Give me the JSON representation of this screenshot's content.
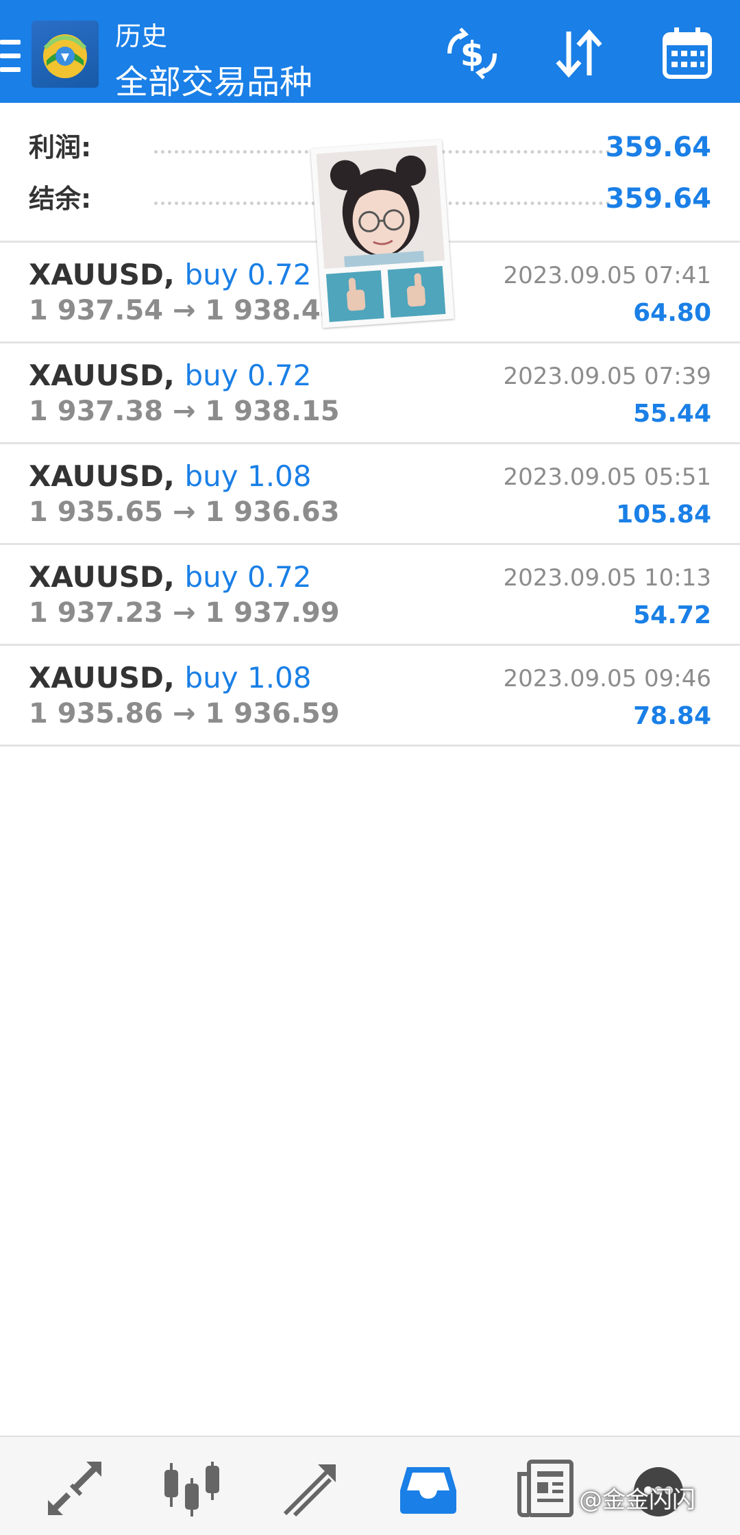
{
  "header": {
    "subtitle": "历史",
    "title": "全部交易品种",
    "icons": {
      "menu": "hamburger-icon",
      "logo": "metatrader-logo-icon",
      "currency": "currency-exchange-icon",
      "sort": "sort-icon",
      "calendar": "calendar-icon"
    }
  },
  "summary": {
    "profit_label": "利润:",
    "profit_value": "359.64",
    "balance_label": "结余:",
    "balance_value": "359.64"
  },
  "trades": [
    {
      "symbol": "XAUUSD,",
      "side": "buy 0.72",
      "prices": "1 937.54 → 1 938.44",
      "time": "2023.09.05 07:41",
      "profit": "64.80"
    },
    {
      "symbol": "XAUUSD,",
      "side": "buy 0.72",
      "prices": "1 937.38 → 1 938.15",
      "time": "2023.09.05 07:39",
      "profit": "55.44"
    },
    {
      "symbol": "XAUUSD,",
      "side": "buy 1.08",
      "prices": "1 935.65 → 1 936.63",
      "time": "2023.09.05 05:51",
      "profit": "105.84"
    },
    {
      "symbol": "XAUUSD,",
      "side": "buy 0.72",
      "prices": "1 937.23 → 1 937.99",
      "time": "2023.09.05 10:13",
      "profit": "54.72"
    },
    {
      "symbol": "XAUUSD,",
      "side": "buy 1.08",
      "prices": "1 935.86 → 1 936.59",
      "time": "2023.09.05 09:46",
      "profit": "78.84"
    }
  ],
  "bottom_nav": {
    "items": [
      "quotes-icon",
      "chart-candles-icon",
      "trade-icon",
      "history-inbox-icon",
      "news-icon",
      "chat-icon"
    ],
    "active": "history-inbox-icon"
  },
  "watermark": "@金金闪闪",
  "colors": {
    "accent": "#1a7fe6",
    "text_dark": "#333333",
    "text_muted": "#8c8c8c",
    "divider": "#e3e3e3"
  }
}
